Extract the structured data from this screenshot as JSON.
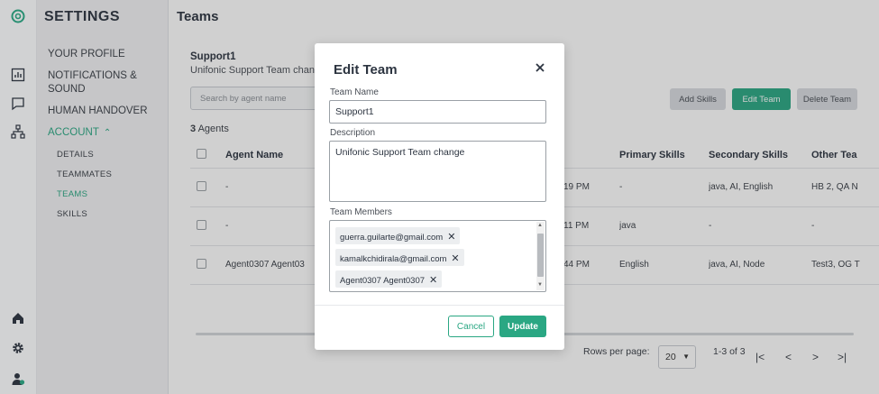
{
  "app": {
    "logo_icon": "brand-logo-icon",
    "accent_color": "#2aa783"
  },
  "rail": {
    "icons": [
      "bar-chart-icon",
      "chat-icon",
      "sitemap-icon",
      "home-icon",
      "gear-icon",
      "user-status-icon"
    ]
  },
  "sidebar": {
    "title": "SETTINGS",
    "items": [
      {
        "label": "YOUR PROFILE"
      },
      {
        "label": "NOTIFICATIONS & SOUND"
      },
      {
        "label": "HUMAN HANDOVER"
      },
      {
        "label": "ACCOUNT"
      }
    ],
    "account_chevron": "⌃",
    "sub_items": [
      {
        "label": "DETAILS"
      },
      {
        "label": "TEAMMATES"
      },
      {
        "label": "TEAMS"
      },
      {
        "label": "SKILLS"
      }
    ]
  },
  "main": {
    "page_title": "Teams",
    "team_name": "Support1",
    "team_description": "Unifonic Support Team chang",
    "search_placeholder": "Search by agent name",
    "add_skills": "Add Skills",
    "edit_team": "Edit Team",
    "delete_team": "Delete Team",
    "agents_count_num": "3",
    "agents_count_label": "Agents",
    "columns": [
      "Agent Name",
      "",
      "Primary Skills",
      "Secondary Skills",
      "Other Tea"
    ],
    "rows": [
      {
        "name": "-",
        "time": "19 PM",
        "primary": "-",
        "secondary": "java, AI, English",
        "other": "HB 2, QA N"
      },
      {
        "name": "-",
        "time": "11 PM",
        "primary": "java",
        "secondary": "-",
        "other": "-"
      },
      {
        "name": "Agent0307 Agent03",
        "time": "44 PM",
        "primary": "English",
        "secondary": "java, AI, Node",
        "other": "Test3, OG T"
      }
    ],
    "rows_per_page_label": "Rows per page:",
    "rows_per_page_value": "20",
    "page_range": "1-3 of 3"
  },
  "modal": {
    "title": "Edit Team",
    "team_name_label": "Team Name",
    "team_name_value": "Support1",
    "description_label": "Description",
    "description_value": "Unifonic Support Team change",
    "members_label": "Team Members",
    "members": [
      {
        "label": "guerra.guilarte@gmail.com"
      },
      {
        "label": "kamalkchidirala@gmail.com"
      },
      {
        "label": "Agent0307 Agent0307"
      }
    ],
    "cancel": "Cancel",
    "update": "Update"
  }
}
